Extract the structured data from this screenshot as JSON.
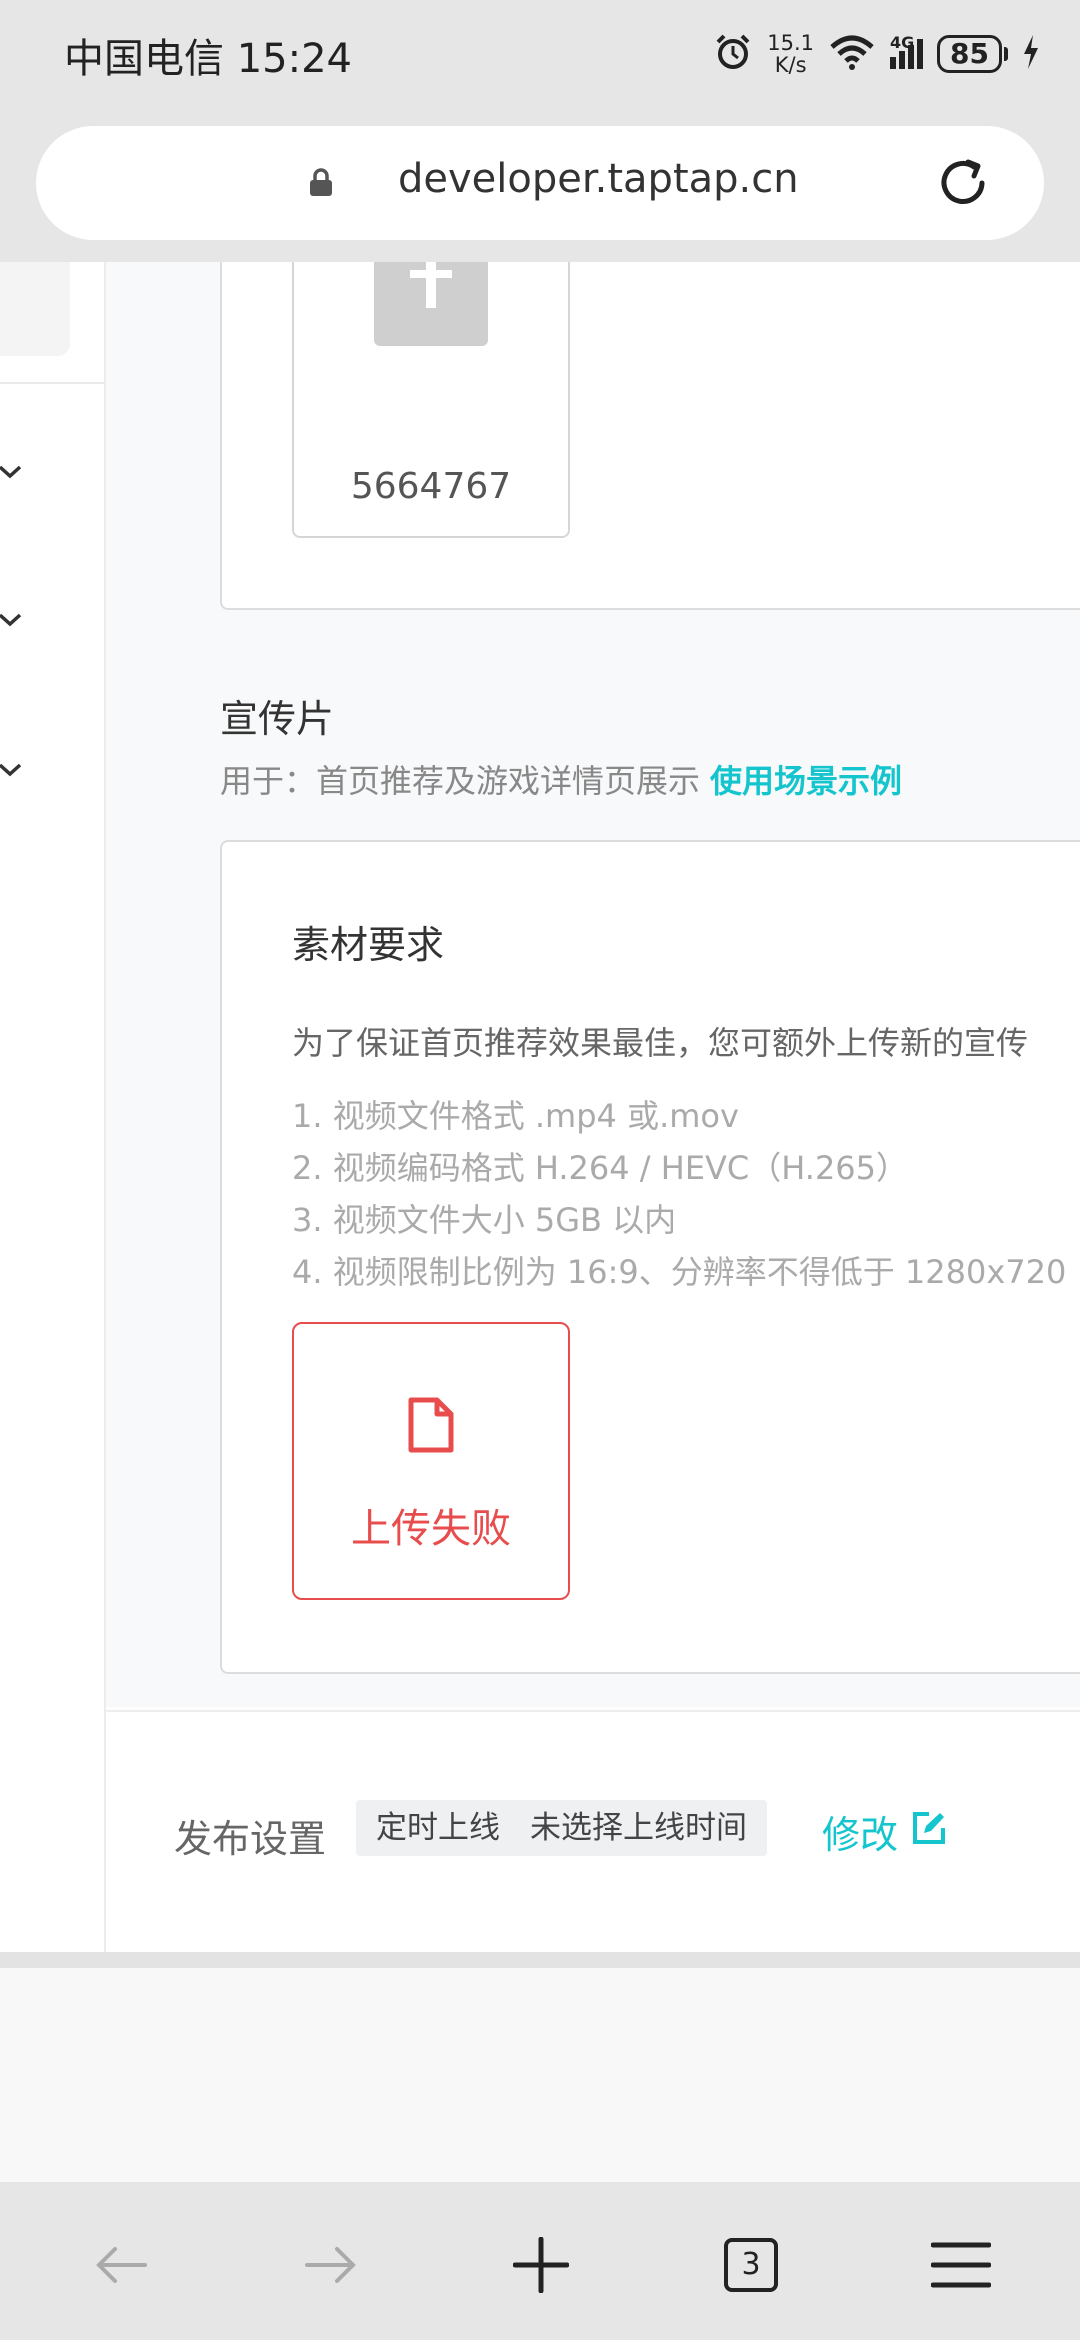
{
  "status_bar": {
    "carrier_time": "中国电信 15:24",
    "net_speed_value": "15.1",
    "net_speed_unit": "K/s",
    "network": "4G",
    "battery": "85"
  },
  "address_bar": {
    "url": "developer.taptap.cn"
  },
  "upload_preview": {
    "id": "5664767"
  },
  "promo_section": {
    "title": "宣传片",
    "subtitle": "用于：首页推荐及游戏详情页展示",
    "example_link": "使用场景示例"
  },
  "requirements": {
    "title": "素材要求",
    "description": "为了保证首页推荐效果最佳，您可额外上传新的宣传",
    "items": [
      "1. 视频文件格式 .mp4 或.mov",
      "2. 视频编码格式 H.264 / HEVC（H.265）",
      "3. 视频文件大小 5GB 以内",
      "4. 视频限制比例为 16:9、分辨率不得低于 1280x720"
    ]
  },
  "upload_status": {
    "text": "上传失败",
    "color": "#e84d4d"
  },
  "publish": {
    "label": "发布设置",
    "mode": "定时上线",
    "time": "未选择上线时间",
    "edit": "修改"
  },
  "browser_nav": {
    "tab_count": "3"
  },
  "colors": {
    "accent": "#15c5ce",
    "error": "#e84d4d"
  }
}
